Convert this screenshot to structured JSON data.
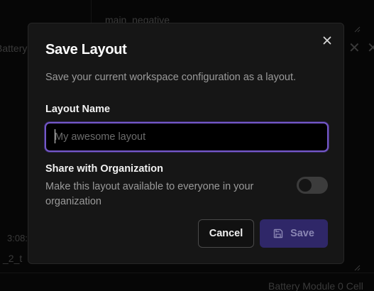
{
  "background": {
    "texts": {
      "top": "main_negative",
      "left": "Battery",
      "time": "3:08:",
      "small": "_2_t",
      "bottom": "Battery Module 0 Cell"
    }
  },
  "dialog": {
    "title": "Save Layout",
    "description": "Save your current workspace configuration as a layout.",
    "layout_name": {
      "label": "Layout Name",
      "value": "",
      "placeholder": "My awesome layout"
    },
    "share": {
      "title": "Share with Organization",
      "description": "Make this layout available to everyone in your organization",
      "enabled": false
    },
    "buttons": {
      "cancel": "Cancel",
      "save": "Save"
    },
    "icons": {
      "close": "close-icon",
      "save": "save-icon"
    },
    "colors": {
      "accent": "#7458c9",
      "save_button_bg": "#2f2768"
    }
  }
}
